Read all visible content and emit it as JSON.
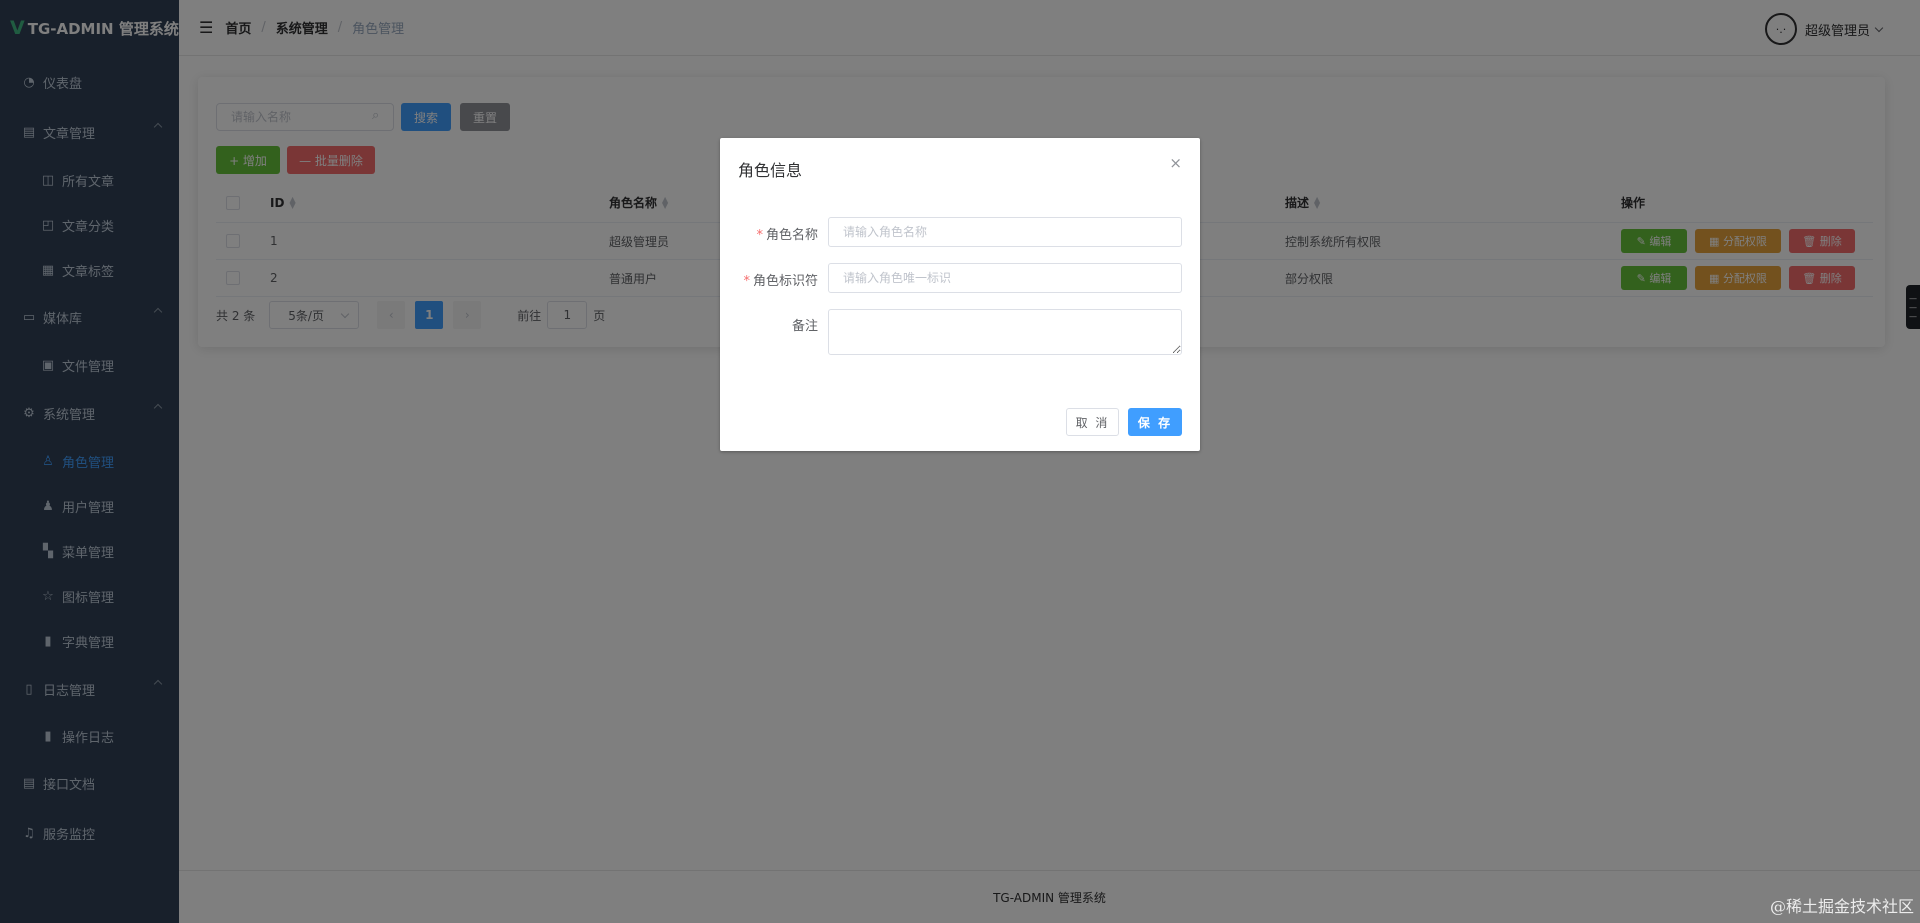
{
  "sidebar": {
    "logo_mark": "V",
    "logo_text": "TG-ADMIN 管理系统",
    "items": [
      {
        "label": "仪表盘",
        "icon": "dashboard-icon"
      },
      {
        "label": "文章管理",
        "icon": "document-icon"
      },
      {
        "label": "所有文章",
        "icon": "book-icon"
      },
      {
        "label": "文章分类",
        "icon": "folder-icon"
      },
      {
        "label": "文章标签",
        "icon": "grid-icon"
      },
      {
        "label": "媒体库",
        "icon": "folder-icon"
      },
      {
        "label": "文件管理",
        "icon": "image-icon"
      },
      {
        "label": "系统管理",
        "icon": "gear-icon"
      },
      {
        "label": "角色管理",
        "icon": "user-icon"
      },
      {
        "label": "用户管理",
        "icon": "user-icon"
      },
      {
        "label": "菜单管理",
        "icon": "menu-grid-icon"
      },
      {
        "label": "图标管理",
        "icon": "star-icon"
      },
      {
        "label": "字典管理",
        "icon": "bar-chart-icon"
      },
      {
        "label": "日志管理",
        "icon": "log-icon"
      },
      {
        "label": "操作日志",
        "icon": "bar-chart-icon"
      },
      {
        "label": "接口文档",
        "icon": "api-doc-icon"
      },
      {
        "label": "服务监控",
        "icon": "bell-icon"
      }
    ]
  },
  "header": {
    "breadcrumb": [
      "首页",
      "系统管理",
      "角色管理"
    ],
    "breadcrumb_sep": "/",
    "avatar_text": "·.·",
    "user_name": "超级管理员"
  },
  "toolbar": {
    "search_placeholder": "请输入名称",
    "search_label": "搜索",
    "reset_label": "重置",
    "add_label": "+ 增加",
    "batch_delete_label": "— 批量删除"
  },
  "table": {
    "columns": [
      "ID",
      "角色名称",
      "描述",
      "操作"
    ],
    "rows": [
      {
        "id": "1",
        "name": "超级管理员",
        "desc": "控制系统所有权限"
      },
      {
        "id": "2",
        "name": "普通用户",
        "desc": "部分权限"
      }
    ],
    "op_edit": "编辑",
    "op_assign": "分配权限",
    "op_delete": "删除"
  },
  "pagination": {
    "total_text": "共 2 条",
    "page_size": "5条/页",
    "prev": "‹",
    "next": "›",
    "current_page": "1",
    "goto_prefix": "前往",
    "goto_value": "1",
    "goto_suffix": "页"
  },
  "footer": {
    "text": "TG-ADMIN 管理系统"
  },
  "watermark": "@稀土掘金技术社区",
  "dialog": {
    "title": "角色信息",
    "close": "×",
    "required_mark": "*",
    "name_label": "角色名称",
    "name_placeholder": "请输入角色名称",
    "key_label": "角色标识符",
    "key_placeholder": "请输入角色唯一标识",
    "remark_label": "备注",
    "remark_value": "",
    "cancel_label": "取 消",
    "save_label": "保 存"
  },
  "colors": {
    "primary": "#409eff",
    "success": "#67c23a",
    "warning": "#e6a23c",
    "danger": "#f56c6c",
    "info": "#909399",
    "sidebar_bg": "#304156"
  }
}
